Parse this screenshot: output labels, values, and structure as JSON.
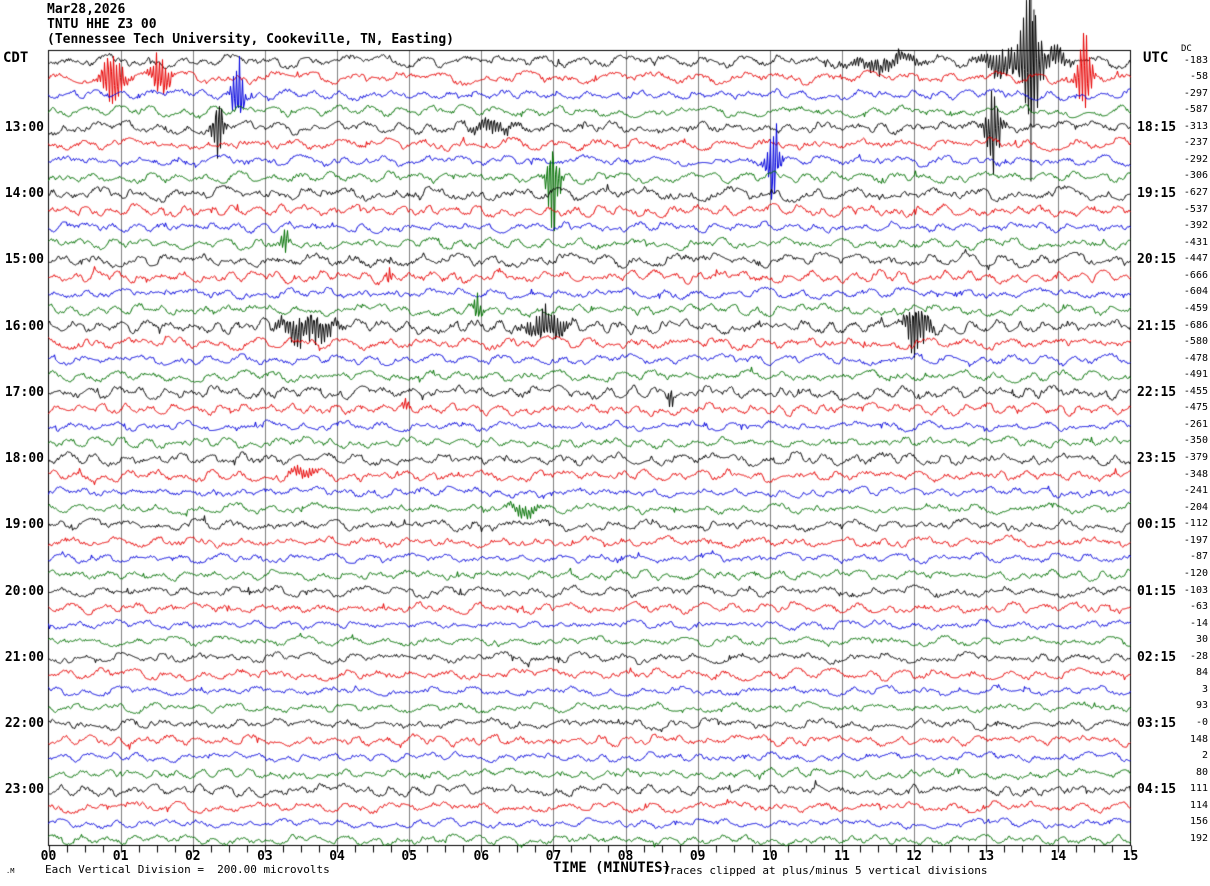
{
  "header": {
    "date": "Mar28,2026",
    "station": "TNTU HHE Z3 00",
    "location": "(Tennessee Tech University, Cookeville, TN, Easting)"
  },
  "left_axis": {
    "timezone": "CDT"
  },
  "right_axis": {
    "timezone": "UTC",
    "dc_header": "DC"
  },
  "x_axis": {
    "title": "TIME (MINUTES)",
    "tick_labels": [
      "00",
      "01",
      "02",
      "03",
      "04",
      "05",
      "06",
      "07",
      "08",
      "09",
      "10",
      "11",
      "12",
      "13",
      "14",
      "15"
    ],
    "minutes_per_line": 15,
    "ticks_per_minute": 4
  },
  "footer": {
    "scale_note": "Each Vertical Division =  200.00 microvolts",
    "clip_note": "Traces clipped at plus/minus 5 vertical divisions",
    "mark": ".M"
  },
  "colors": {
    "black": "#000000",
    "red": "#e80000",
    "blue": "#0000dd",
    "green": "#007000",
    "grid": "#808080",
    "frame": "#000000",
    "bg": "#ffffff"
  },
  "chart_data": {
    "type": "line",
    "subtype": "helicorder-seismogram",
    "title": "TNTU HHE Z3 00 helicorder, Mar28,2026",
    "xlabel": "TIME (MINUTES)",
    "x_range_minutes": [
      0,
      15
    ],
    "rows_count": 48,
    "row_duration_minutes": 15,
    "row_color_cycle": [
      "black",
      "red",
      "blue",
      "green"
    ],
    "vertical_division_microvolts": 200.0,
    "clip_divisions": 5,
    "rows": [
      {
        "color": "black",
        "cdt": "",
        "utc": "",
        "dc": "-183",
        "amp": 3.6,
        "events": [
          {
            "m": 11.6,
            "a": 7,
            "w": 0.5
          },
          {
            "m": 13.25,
            "a": 13,
            "w": 0.3
          },
          {
            "m": 13.62,
            "a": 62,
            "w": 0.14,
            "tail": 120
          },
          {
            "m": 13.95,
            "a": 9,
            "w": 0.2
          }
        ]
      },
      {
        "color": "red",
        "cdt": "",
        "utc": "",
        "dc": "-58",
        "amp": 3.5,
        "events": [
          {
            "m": 0.9,
            "a": 24,
            "w": 0.15
          },
          {
            "m": 1.55,
            "a": 22,
            "w": 0.12
          },
          {
            "m": 14.35,
            "a": 38,
            "w": 0.1
          }
        ]
      },
      {
        "color": "blue",
        "cdt": "",
        "utc": "",
        "dc": "-297",
        "amp": 3.0,
        "events": [
          {
            "m": 2.62,
            "a": 34,
            "w": 0.08
          }
        ]
      },
      {
        "color": "green",
        "cdt": "",
        "utc": "",
        "dc": "-587",
        "amp": 3.1,
        "events": []
      },
      {
        "color": "black",
        "cdt": "13:00",
        "utc": "18:15",
        "dc": "-313",
        "amp": 3.6,
        "events": [
          {
            "m": 2.35,
            "a": 30,
            "w": 0.08
          },
          {
            "m": 6.15,
            "a": 7,
            "w": 0.3
          },
          {
            "m": 13.1,
            "a": 40,
            "w": 0.1
          }
        ]
      },
      {
        "color": "red",
        "cdt": "",
        "utc": "",
        "dc": "-237",
        "amp": 3.4,
        "events": []
      },
      {
        "color": "blue",
        "cdt": "",
        "utc": "",
        "dc": "-292",
        "amp": 3.0,
        "events": [
          {
            "m": 10.05,
            "a": 36,
            "w": 0.09
          }
        ]
      },
      {
        "color": "green",
        "cdt": "",
        "utc": "",
        "dc": "-306",
        "amp": 3.2,
        "events": [
          {
            "m": 7.0,
            "a": 42,
            "w": 0.09
          }
        ]
      },
      {
        "color": "black",
        "cdt": "14:00",
        "utc": "19:15",
        "dc": "-627",
        "amp": 4.0,
        "events": []
      },
      {
        "color": "red",
        "cdt": "",
        "utc": "",
        "dc": "-537",
        "amp": 3.5,
        "events": []
      },
      {
        "color": "blue",
        "cdt": "",
        "utc": "",
        "dc": "-392",
        "amp": 3.0,
        "events": []
      },
      {
        "color": "green",
        "cdt": "",
        "utc": "",
        "dc": "-431",
        "amp": 3.2,
        "events": [
          {
            "m": 3.28,
            "a": 12,
            "w": 0.05
          }
        ]
      },
      {
        "color": "black",
        "cdt": "15:00",
        "utc": "20:15",
        "dc": "-447",
        "amp": 3.8,
        "events": []
      },
      {
        "color": "red",
        "cdt": "",
        "utc": "",
        "dc": "-666",
        "amp": 3.6,
        "events": [
          {
            "m": 4.72,
            "a": 8,
            "w": 0.04
          }
        ]
      },
      {
        "color": "blue",
        "cdt": "",
        "utc": "",
        "dc": "-604",
        "amp": 3.0,
        "events": []
      },
      {
        "color": "green",
        "cdt": "",
        "utc": "",
        "dc": "-459",
        "amp": 3.2,
        "events": [
          {
            "m": 5.95,
            "a": 12,
            "w": 0.06
          }
        ]
      },
      {
        "color": "black",
        "cdt": "16:00",
        "utc": "21:15",
        "dc": "-686",
        "amp": 4.0,
        "events": [
          {
            "m": 3.6,
            "a": 16,
            "w": 0.35
          },
          {
            "m": 6.9,
            "a": 15,
            "w": 0.25
          },
          {
            "m": 12.05,
            "a": 26,
            "w": 0.15
          }
        ]
      },
      {
        "color": "red",
        "cdt": "",
        "utc": "",
        "dc": "-580",
        "amp": 3.6,
        "events": []
      },
      {
        "color": "blue",
        "cdt": "",
        "utc": "",
        "dc": "-478",
        "amp": 3.0,
        "events": []
      },
      {
        "color": "green",
        "cdt": "",
        "utc": "",
        "dc": "-491",
        "amp": 3.2,
        "events": []
      },
      {
        "color": "black",
        "cdt": "17:00",
        "utc": "22:15",
        "dc": "-455",
        "amp": 3.8,
        "events": [
          {
            "m": 8.62,
            "a": 10,
            "w": 0.04
          }
        ]
      },
      {
        "color": "red",
        "cdt": "",
        "utc": "",
        "dc": "-475",
        "amp": 3.4,
        "events": [
          {
            "m": 4.95,
            "a": 6,
            "w": 0.05
          }
        ]
      },
      {
        "color": "blue",
        "cdt": "",
        "utc": "",
        "dc": "-261",
        "amp": 2.8,
        "events": []
      },
      {
        "color": "green",
        "cdt": "",
        "utc": "",
        "dc": "-350",
        "amp": 3.0,
        "events": []
      },
      {
        "color": "black",
        "cdt": "18:00",
        "utc": "23:15",
        "dc": "-379",
        "amp": 3.6,
        "events": []
      },
      {
        "color": "red",
        "cdt": "",
        "utc": "",
        "dc": "-348",
        "amp": 3.4,
        "events": [
          {
            "m": 3.5,
            "a": 6,
            "w": 0.2
          }
        ]
      },
      {
        "color": "blue",
        "cdt": "",
        "utc": "",
        "dc": "-241",
        "amp": 2.8,
        "events": []
      },
      {
        "color": "green",
        "cdt": "",
        "utc": "",
        "dc": "-204",
        "amp": 3.0,
        "events": [
          {
            "m": 6.6,
            "a": 6,
            "w": 0.2
          }
        ]
      },
      {
        "color": "black",
        "cdt": "19:00",
        "utc": "00:15",
        "dc": "-112",
        "amp": 3.4,
        "events": []
      },
      {
        "color": "red",
        "cdt": "",
        "utc": "",
        "dc": "-197",
        "amp": 3.2,
        "events": []
      },
      {
        "color": "blue",
        "cdt": "",
        "utc": "",
        "dc": "-87",
        "amp": 2.8,
        "events": []
      },
      {
        "color": "green",
        "cdt": "",
        "utc": "",
        "dc": "-120",
        "amp": 3.0,
        "events": []
      },
      {
        "color": "black",
        "cdt": "20:00",
        "utc": "01:15",
        "dc": "-103",
        "amp": 3.2,
        "events": []
      },
      {
        "color": "red",
        "cdt": "",
        "utc": "",
        "dc": "-63",
        "amp": 3.2,
        "events": []
      },
      {
        "color": "blue",
        "cdt": "",
        "utc": "",
        "dc": "-14",
        "amp": 2.6,
        "events": []
      },
      {
        "color": "green",
        "cdt": "",
        "utc": "",
        "dc": "30",
        "amp": 2.8,
        "events": []
      },
      {
        "color": "black",
        "cdt": "21:00",
        "utc": "02:15",
        "dc": "-28",
        "amp": 3.2,
        "events": []
      },
      {
        "color": "red",
        "cdt": "",
        "utc": "",
        "dc": "84",
        "amp": 3.2,
        "events": []
      },
      {
        "color": "blue",
        "cdt": "",
        "utc": "",
        "dc": "3",
        "amp": 2.8,
        "events": []
      },
      {
        "color": "green",
        "cdt": "",
        "utc": "",
        "dc": "93",
        "amp": 2.8,
        "events": []
      },
      {
        "color": "black",
        "cdt": "22:00",
        "utc": "03:15",
        "dc": "-0",
        "amp": 3.2,
        "events": []
      },
      {
        "color": "red",
        "cdt": "",
        "utc": "",
        "dc": "148",
        "amp": 3.2,
        "events": []
      },
      {
        "color": "blue",
        "cdt": "",
        "utc": "",
        "dc": "2",
        "amp": 2.6,
        "events": []
      },
      {
        "color": "green",
        "cdt": "",
        "utc": "",
        "dc": "80",
        "amp": 2.8,
        "events": []
      },
      {
        "color": "black",
        "cdt": "23:00",
        "utc": "04:15",
        "dc": "111",
        "amp": 3.4,
        "events": []
      },
      {
        "color": "red",
        "cdt": "",
        "utc": "",
        "dc": "114",
        "amp": 3.2,
        "events": []
      },
      {
        "color": "blue",
        "cdt": "",
        "utc": "",
        "dc": "156",
        "amp": 2.6,
        "events": []
      },
      {
        "color": "green",
        "cdt": "",
        "utc": "",
        "dc": "192",
        "amp": 2.8,
        "events": []
      }
    ]
  }
}
